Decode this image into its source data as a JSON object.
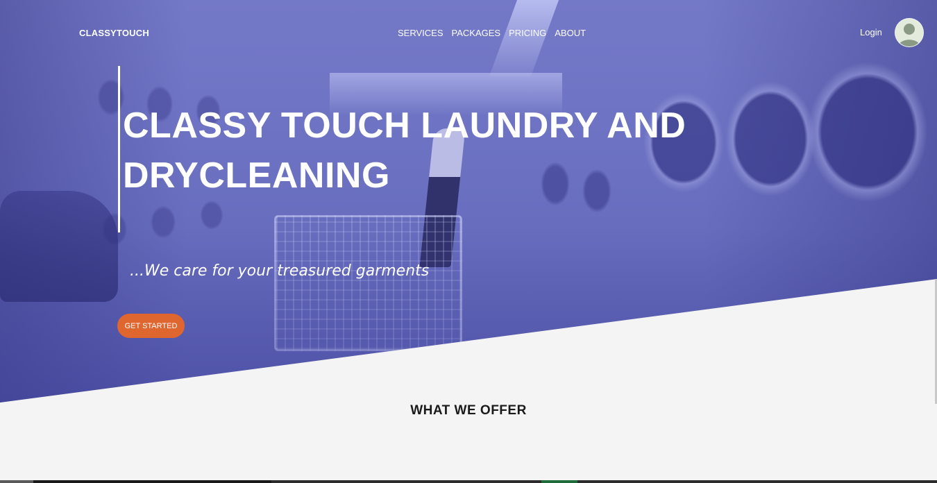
{
  "brand": {
    "name": "CLASSYTOUCH"
  },
  "nav": {
    "links": [
      {
        "label": "SERVICES"
      },
      {
        "label": "PACKAGES"
      },
      {
        "label": "PRICING"
      },
      {
        "label": "ABOUT"
      }
    ],
    "login_label": "Login",
    "avatar_icon": "user-avatar-icon"
  },
  "hero": {
    "title_line1": "CLASSY TOUCH LAUNDRY AND",
    "title_line2": "DRYCLEANING",
    "tagline": "...We care for your treasured garments",
    "cta_label": "GET STARTED",
    "overlay_color": "#6d72c4",
    "cta_color": "#e0662f"
  },
  "offer": {
    "title": "WHAT WE OFFER"
  }
}
